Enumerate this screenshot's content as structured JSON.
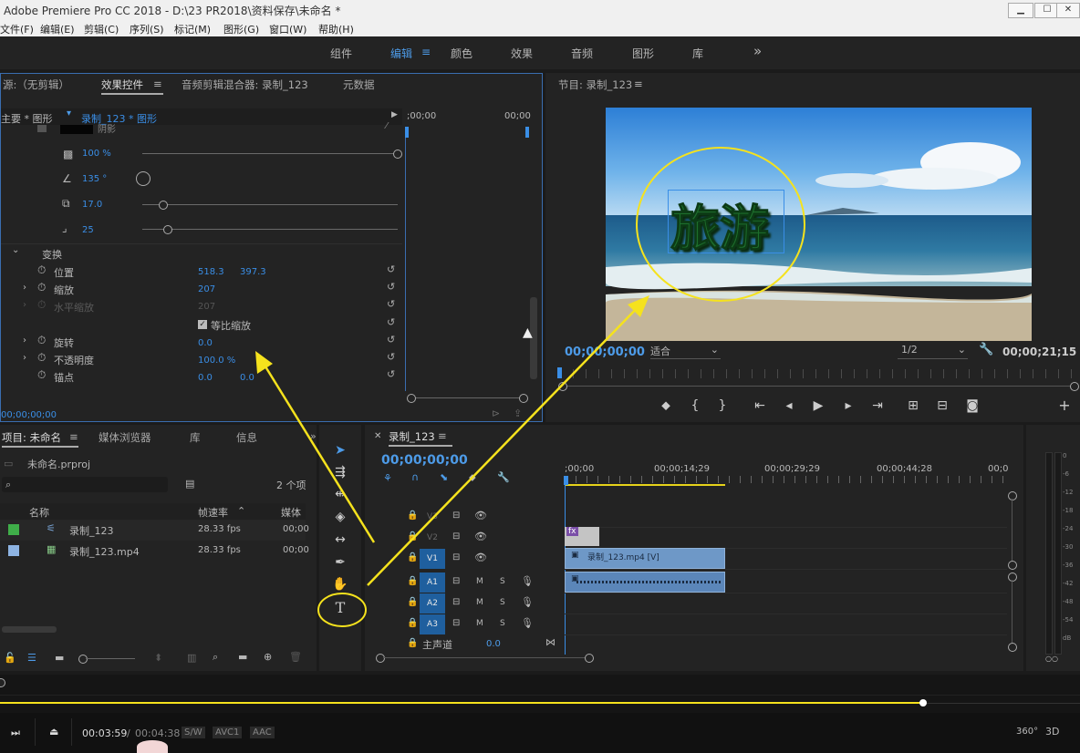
{
  "window": {
    "title": "Adobe Premiere Pro CC 2018 - D:\\23 PR2018\\资料保存\\未命名 *",
    "min": "▁",
    "max": "☐",
    "close": "✕"
  },
  "menu": [
    "文件(F)",
    "编辑(E)",
    "剪辑(C)",
    "序列(S)",
    "标记(M)",
    "图形(G)",
    "窗口(W)",
    "帮助(H)"
  ],
  "workspaces": [
    "组件",
    "编辑",
    "颜色",
    "效果",
    "音频",
    "图形",
    "库"
  ],
  "workspace_more": "»",
  "effect_panel": {
    "tabs": [
      "源:（无剪辑）",
      "效果控件",
      "音频剪辑混合器: 录制_123",
      "元数据"
    ],
    "source_label": "主要 * 图形",
    "sequence_label": "录制_123 * 图形",
    "timecode_start": ";00;00",
    "timecode_end": "00;00",
    "shadow_label": "阴影",
    "opacity_value": "100 %",
    "angle_value": "135 °",
    "distance_value": "17.0",
    "blur_value": "25",
    "transform_label": "变换",
    "position_label": "位置",
    "position_x": "518.3",
    "position_y": "397.3",
    "scale_label": "缩放",
    "scale_value": "207",
    "hscale_label": "水平缩放",
    "hscale_value": "207",
    "uniform_label": "等比缩放",
    "rotation_label": "旋转",
    "rotation_value": "0.0",
    "opacity_label": "不透明度",
    "opacity2_value": "100.0 %",
    "anchor_label": "锚点",
    "anchor_x": "0.0",
    "anchor_y": "0.0",
    "footer_time": "00;00;00;00"
  },
  "program_monitor": {
    "title": "节目: 录制_123",
    "overlay_text": "旅游",
    "current_time": "00;00;00;00",
    "fit_label": "适合",
    "resolution": "1/2",
    "duration": "00;00;21;15"
  },
  "project_panel": {
    "tabs": [
      "项目: 未命名",
      "媒体浏览器",
      "库",
      "信息"
    ],
    "project_file": "未命名.prproj",
    "item_count": "2 个项",
    "columns": [
      "名称",
      "帧速率",
      "媒体"
    ],
    "items": [
      {
        "name": "录制_123",
        "fps": "28.33 fps",
        "media": "00;00",
        "color": "#3fae49"
      },
      {
        "name": "录制_123.mp4",
        "fps": "28.33 fps",
        "media": "00;00",
        "color": "#8eb4e3"
      }
    ]
  },
  "timeline": {
    "tab": "录制_123",
    "timecode": "00;00;00;00",
    "ruler": [
      ";00;00",
      "00;00;14;29",
      "00;00;29;29",
      "00;00;44;28",
      "00;0"
    ],
    "video_tracks": [
      "V3",
      "V2",
      "V1"
    ],
    "audio_tracks": [
      "A1",
      "A2",
      "A3"
    ],
    "master_label": "主声道",
    "master_value": "0.0",
    "clip_label": "录制_123.mp4 [V]",
    "fx_label": "fx",
    "m": "M",
    "s": "S"
  },
  "meter_scale": [
    "0",
    "-6",
    "-12",
    "-18",
    "-24",
    "-30",
    "-36",
    "-42",
    "-48",
    "-54",
    "dB"
  ],
  "player": {
    "current": "00:03:59",
    "separator": "/",
    "total": "00:04:38",
    "tags": [
      "S/W",
      "AVC1",
      "AAC"
    ],
    "deg": "360°",
    "mode": "3D",
    "progress": 0.855
  },
  "colors": {
    "accent": "#3a8ee6",
    "annotation": "#f5e21d"
  }
}
